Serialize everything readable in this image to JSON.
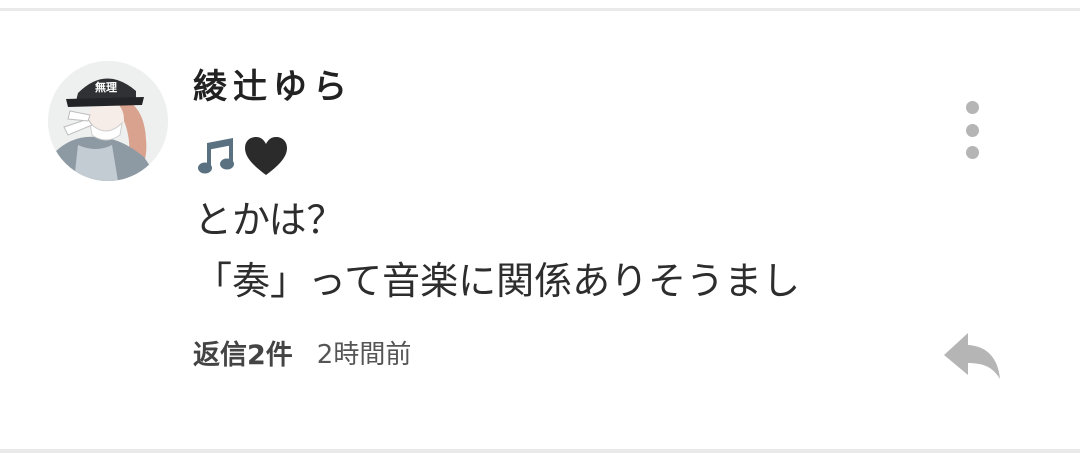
{
  "comment": {
    "username": "綾辻ゆら",
    "emojis": [
      "musical-notes-icon",
      "black-heart-icon"
    ],
    "body_lines": [
      "とかは？",
      "「奏」って音楽に関係ありそうまし"
    ],
    "reply_count_label": "返信2件",
    "timestamp": "2時間前",
    "avatar_cap_text": "無理"
  },
  "actions": {
    "more_icon": "vertical-ellipsis-icon",
    "reply_icon": "reply-arrow-icon"
  },
  "colors": {
    "background": "#ffffff",
    "divider": "#e9e9e9",
    "username": "#222222",
    "body_text": "#2d2d2d",
    "icon_gray": "#b5b5b5",
    "emoji_note": "#5a7181",
    "emoji_heart": "#2b2b2b"
  }
}
